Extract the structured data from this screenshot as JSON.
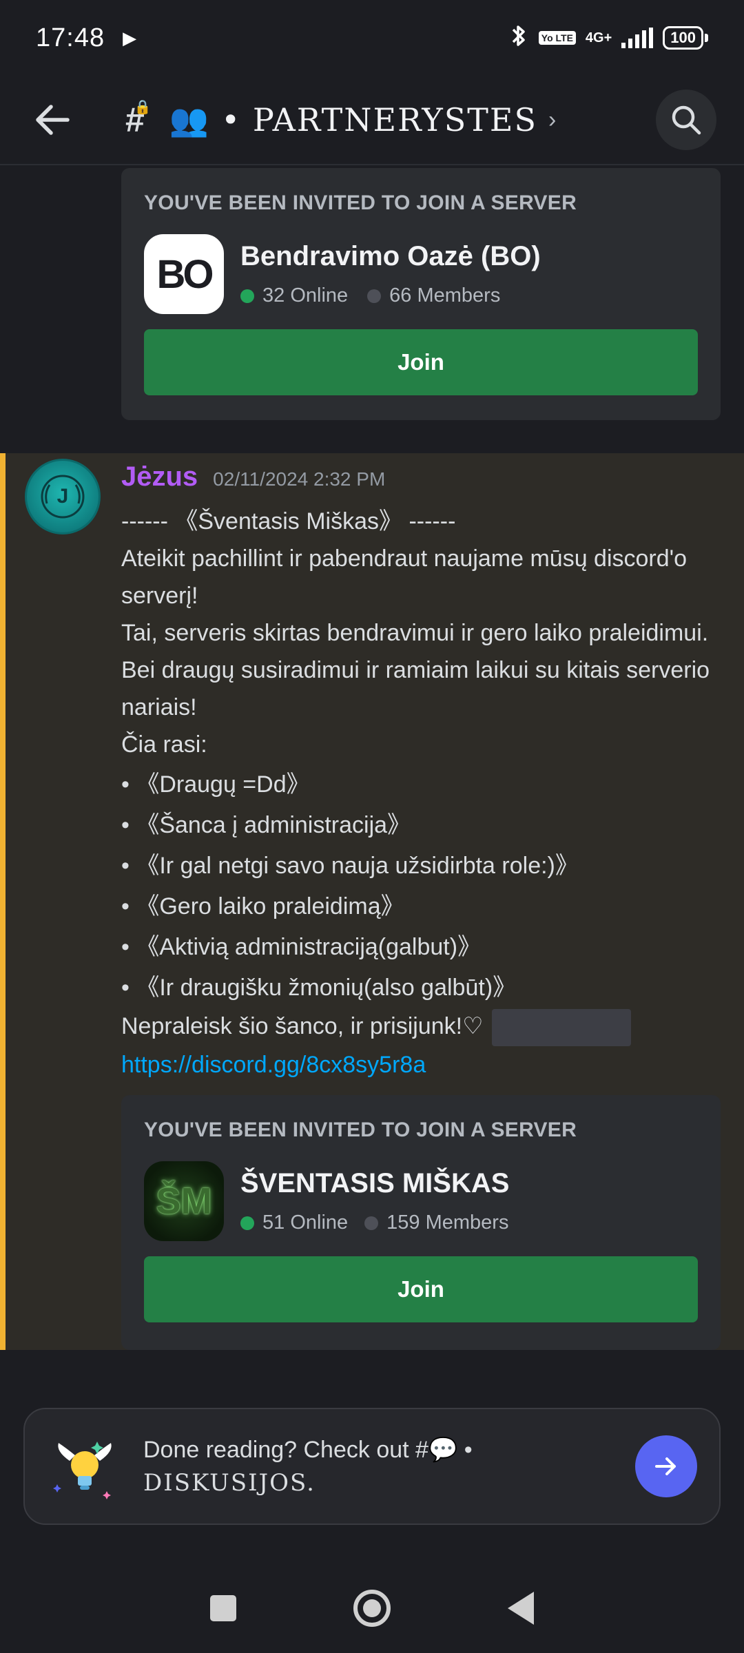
{
  "status_bar": {
    "time": "17:48",
    "lte_label": "Yo LTE",
    "network": "4G+",
    "battery": "100"
  },
  "header": {
    "channel_emoji": "👥",
    "channel_name": "• PARTNERYSTES"
  },
  "invite_1": {
    "heading": "YOU'VE BEEN INVITED TO JOIN A SERVER",
    "icon_text": "BO",
    "server_name": "Bendravimo Oazė (BO)",
    "online": "32 Online",
    "members": "66 Members",
    "join_label": "Join"
  },
  "message": {
    "author": "Jėzus",
    "author_color": "#b25cf5",
    "timestamp": "02/11/2024 2:32 PM",
    "avatar_label": "J",
    "lines": [
      "------ 《Šventasis Miškas》 ------",
      "Ateikit pachillint ir pabendraut naujame mūsų discord'o serverį!",
      "Tai, serveris skirtas bendravimui ir gero laiko praleidimui. Bei draugų susiradimui ir ramiaim laikui su kitais serverio nariais!",
      "Čia rasi:",
      "• 《Draugų =Dd》",
      "• 《Šanca į administracija》",
      "• 《Ir gal netgi savo nauja užsidirbta role:)》",
      "• 《Gero laiko praleidimą》",
      "• 《Aktivią administraciją(galbut)》",
      "• 《Ir draugišku žmonių(also galbūt)》",
      "Nepraleisk šio šanco, ir prisijunk!♡"
    ],
    "link": "https://discord.gg/8cx8sy5r8a"
  },
  "invite_2": {
    "heading": "YOU'VE BEEN INVITED TO JOIN A SERVER",
    "icon_text": "ŠM",
    "server_name": "ŠVENTASIS MIŠKAS",
    "online": "51 Online",
    "members": "159 Members",
    "join_label": "Join"
  },
  "prompt": {
    "text": "Done reading? Check out #💬 •",
    "channel": "DISKUSIJOS."
  },
  "colors": {
    "accent": "#5865f2",
    "join_green": "#248046",
    "online_green": "#23a55a",
    "mention_bar": "#f0b232",
    "link": "#00a8fc"
  }
}
